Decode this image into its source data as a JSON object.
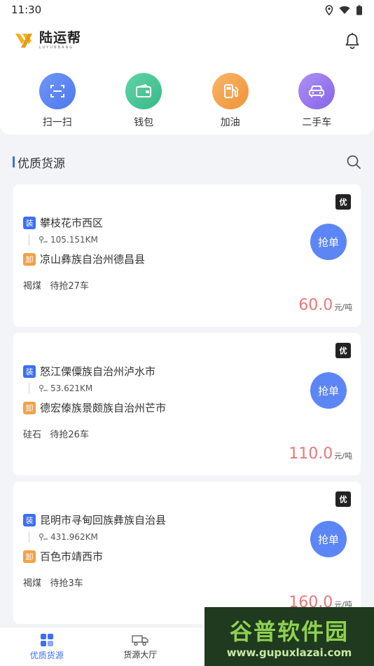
{
  "status": {
    "time": "11:30"
  },
  "header": {
    "logo_cn": "陆运帮",
    "logo_en": "LUYUNBANG"
  },
  "quick": [
    {
      "label": "扫一扫",
      "icon": "scan-icon",
      "color": "#5c86f5"
    },
    {
      "label": "钱包",
      "icon": "wallet-icon",
      "color": "#4cc79a"
    },
    {
      "label": "加油",
      "icon": "fuel-icon",
      "color": "#f5a34c"
    },
    {
      "label": "二手车",
      "icon": "car-icon",
      "color": "#9b7bf0"
    }
  ],
  "section": {
    "title": "优质货源"
  },
  "badge": "优",
  "cards": [
    {
      "load": "攀枝花市西区",
      "distance": "105.151KM",
      "unload": "凉山彝族自治州德昌县",
      "meta": "褐煤   待抢27车",
      "price": "60.0",
      "unit": "元/吨"
    },
    {
      "load": "怒江傈僳族自治州泸水市",
      "distance": "53.621KM",
      "unload": "德宏傣族景颇族自治州芒市",
      "meta": "硅石   待抢26车",
      "price": "110.0",
      "unit": "元/吨"
    },
    {
      "load": "昆明市寻甸回族彝族自治县",
      "distance": "431.962KM",
      "unload": "百色市靖西市",
      "meta": "褐煤   待抢3车",
      "price": "160.0",
      "unit": "元/吨"
    }
  ],
  "tags": {
    "load": "装",
    "unload": "卸",
    "grab": "抢单"
  },
  "tabs": [
    {
      "label": "优质货源"
    },
    {
      "label": "货源大厅"
    }
  ],
  "watermark": {
    "big": "谷普软件园",
    "url": "www.gupuxlazai.com"
  },
  "colors": {
    "accent": "#3d6ff5",
    "price": "#e8787a",
    "load_tag": "#3d6ff5",
    "unload_tag": "#f0a24a"
  }
}
